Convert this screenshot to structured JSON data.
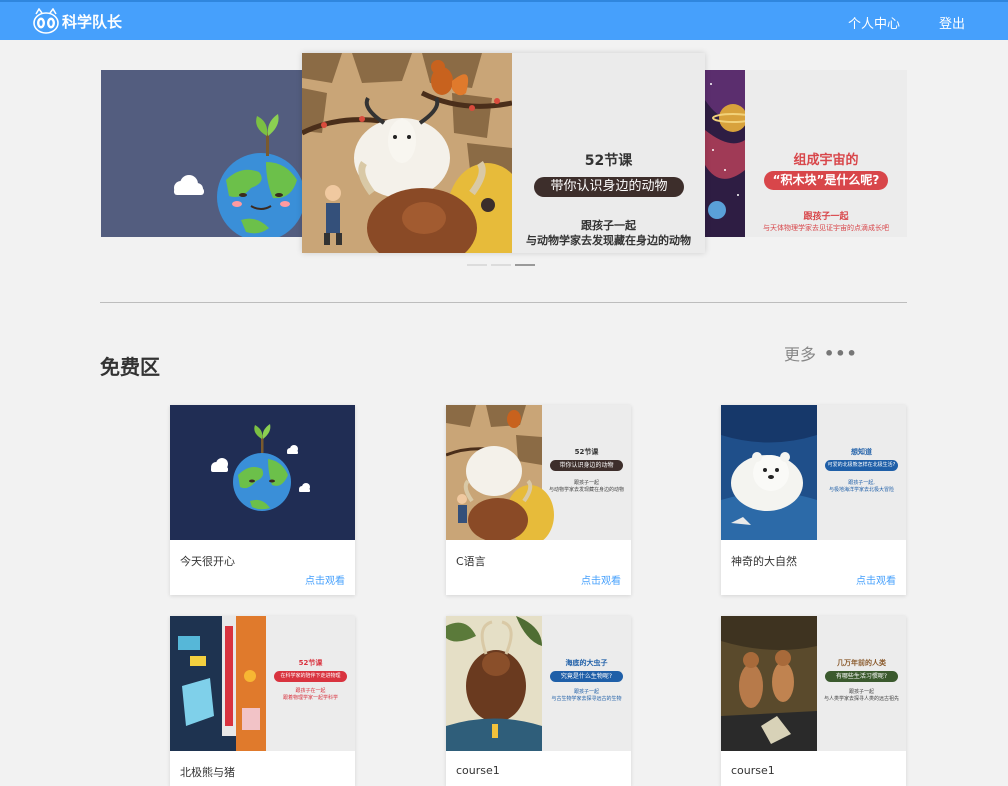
{
  "header": {
    "brand_name": "科学队长",
    "nav": {
      "profile": "个人中心",
      "logout": "登出"
    },
    "bar_color": "#46a0fc"
  },
  "carousel": {
    "active_index": 1,
    "slides": [
      {
        "type": "earth-sprout"
      },
      {
        "type": "animals",
        "title": "52节课",
        "pill": "带你认识身边的动物",
        "line1": "跟孩子一起",
        "line2": "与动物学家去发现藏在身边的动物"
      },
      {
        "type": "universe",
        "title": "组成宇宙的",
        "pill": "“积木块”是什么呢?",
        "line1": "跟孩子一起",
        "line2": "与天体物理学家去见证宇宙的点滴成长吧"
      }
    ]
  },
  "free_section": {
    "title": "免费区",
    "more_label": "更多",
    "more_icon": "ellipsis-icon",
    "courses": [
      {
        "title": "今天很开心",
        "action": "点击观看",
        "thumb": "earth-sprout"
      },
      {
        "title": "C语言",
        "action": "点击观看",
        "thumb": "animals",
        "t_head": "52节课",
        "t_pill": "带你认识身边的动物",
        "t_line1": "跟孩子一起",
        "t_line2": "与动物学家去发现藏在身边的动物"
      },
      {
        "title": "神奇的大自然",
        "action": "点击观看",
        "thumb": "polar-bear",
        "t_head": "想知道",
        "t_pill": "可爱的北极熊怎样在北极生活?",
        "t_line1": "跟孩子一起,",
        "t_line2": "与极地海洋学家去北极大冒险"
      },
      {
        "title": "北极熊与猪",
        "thumb": "physics",
        "t_head": "52节课",
        "t_pill": "在科学家的陪伴下走进物理",
        "t_line1": "跟孩子在一起",
        "t_line2": "跟着物理学家一起学科学"
      },
      {
        "title": "course1",
        "thumb": "insects",
        "t_head": "海底的大虫子",
        "t_pill": "究竟是什么生物呢?",
        "t_line1": "跟孩子一起",
        "t_line2": "与古生物学家去探寻远古的生物"
      },
      {
        "title": "course1",
        "thumb": "ancient-humans",
        "t_head": "几万年前的人类",
        "t_pill": "有哪些生活习惯呢?",
        "t_line1": "跟孩子一起",
        "t_line2": "与人类学家去探寻人类的远古祖先"
      }
    ]
  }
}
